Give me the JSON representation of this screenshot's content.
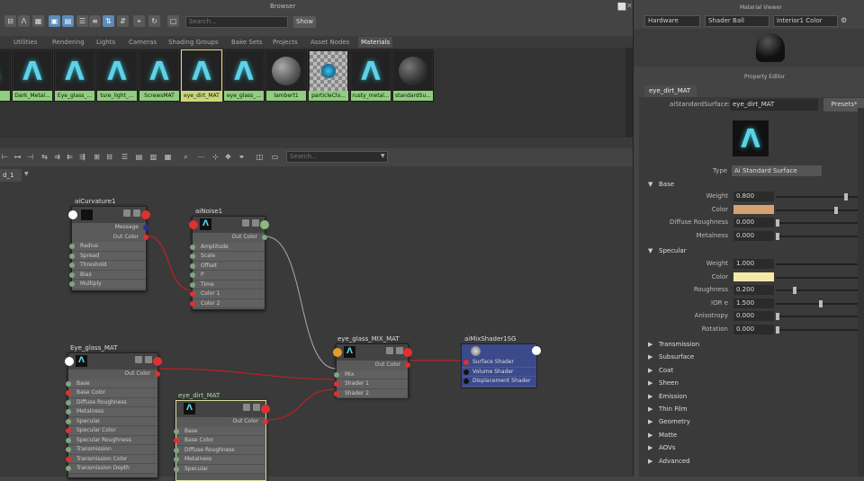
{
  "browser": {
    "title": "Browser",
    "search_placeholder": "Search...",
    "show_label": "Show",
    "tabs": [
      "Utilities",
      "Rendering",
      "Lights",
      "Cameras",
      "Shading Groups",
      "Bake Sets",
      "Projects",
      "Asset Nodes",
      "Materials"
    ],
    "active_tab": "Materials",
    "materials": [
      {
        "label": "",
        "kind": "arnold"
      },
      {
        "label": "Dark_Metal...",
        "kind": "arnold"
      },
      {
        "label": "Eye_glass_...",
        "kind": "arnold"
      },
      {
        "label": "ture_light_...",
        "kind": "arnold"
      },
      {
        "label": "ScrewsMAT",
        "kind": "arnold"
      },
      {
        "label": "eye_dirt_MAT",
        "kind": "arnold",
        "selected": true
      },
      {
        "label": "eye_glass_...",
        "kind": "arnold"
      },
      {
        "label": "lambert1",
        "kind": "ball"
      },
      {
        "label": "particleClo...",
        "kind": "checker"
      },
      {
        "label": "rusty_metal...",
        "kind": "arnold"
      },
      {
        "label": "standardSu...",
        "kind": "ball2"
      }
    ]
  },
  "hypershade": {
    "search_placeholder": "Search...",
    "graph_tab": "d_1"
  },
  "nodes": {
    "curvature": {
      "title": "aiCurvature1",
      "rows": [
        "Radius",
        "Spread",
        "Threshold",
        "Bias",
        "Multiply"
      ],
      "outputs": [
        "Message",
        "Out Color"
      ]
    },
    "noise": {
      "title": "aiNoise1",
      "rows": [
        "Amplitude",
        "Scale",
        "Offset",
        "P",
        "Time",
        "Color 1",
        "Color 2"
      ],
      "output": "Out Color"
    },
    "eye_glass": {
      "title": "Eye_glass_MAT",
      "output": "Out Color",
      "rows": [
        "Base",
        "Base Color",
        "Diffuse Roughness",
        "Metalness",
        "Specular",
        "Specular Color",
        "Specular Roughness",
        "Transmission",
        "Transmission Color",
        "Transmission Depth"
      ]
    },
    "eye_dirt": {
      "title": "eye_dirt_MAT",
      "output": "Out Color",
      "rows": [
        "Base",
        "Base Color",
        "Diffuse Roughness",
        "Metalness",
        "Specular"
      ]
    },
    "mix": {
      "title": "eye_glass_MIX_MAT",
      "output": "Out Color",
      "rows": [
        "Mix",
        "Shader 1",
        "Shader 2"
      ]
    },
    "sg": {
      "title": "aiMixShader1SG",
      "rows": [
        "Surface Shader",
        "Volume Shader",
        "Displacement Shader"
      ]
    }
  },
  "material_viewer": {
    "title": "Material Viewer",
    "renderer": "Hardware",
    "shape": "Shader Ball",
    "env": "Interior1 Color"
  },
  "property_editor": {
    "title": "Property Editor",
    "tab": "eye_dirt_MAT",
    "node_type_label": "aiStandardSurface:",
    "node_name": "eye_dirt_MAT",
    "presets_label": "Presets*",
    "type_label": "Type",
    "type_value": "Ai Standard Surface",
    "base_section": "Base",
    "base": [
      {
        "label": "Weight",
        "value": "0.800",
        "slider": 0.8
      },
      {
        "label": "Color",
        "color": "#d8a170",
        "slider": 0.68
      },
      {
        "label": "Diffuse Roughness",
        "value": "0.000",
        "slider": 0.0
      },
      {
        "label": "Metalness",
        "value": "0.000",
        "slider": 0.0
      }
    ],
    "specular_section": "Specular",
    "specular": [
      {
        "label": "Weight",
        "value": "1.000",
        "slider": 1.0
      },
      {
        "label": "Color",
        "color": "#f6e9a8",
        "slider": 1.0
      },
      {
        "label": "Roughness",
        "value": "0.200",
        "slider": 0.2
      },
      {
        "label": "IOR e",
        "value": "1.500",
        "slider": 0.5
      },
      {
        "label": "Anisotropy",
        "value": "0.000",
        "slider": 0.0
      },
      {
        "label": "Rotation",
        "value": "0.000",
        "slider": 0.0
      }
    ],
    "collapsed_sections": [
      "Transmission",
      "Subsurface",
      "Coat",
      "Sheen",
      "Emission",
      "Thin Film",
      "Geometry",
      "Matte",
      "AOVs",
      "Advanced"
    ]
  }
}
